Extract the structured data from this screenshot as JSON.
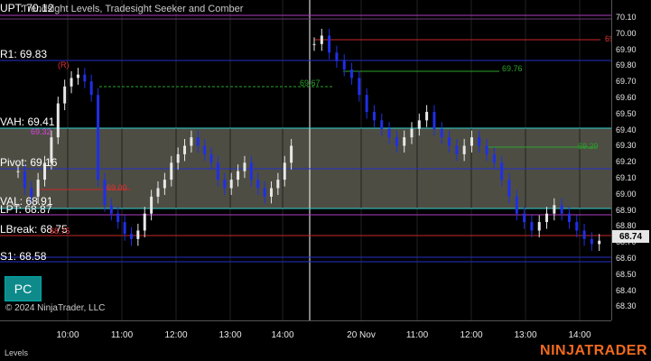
{
  "chart_title": "Trendsight Levels, Tradesight Seeker and Comber",
  "copyright": "© 2024 NinjaTrader, LLC",
  "brand": "NINJATRADER",
  "bottom_tab": "Levels",
  "pc_button": "PC",
  "last_price": "68.74",
  "levels": {
    "upt": "UPT: 70.12",
    "r1": "R1: 69.83",
    "vah": "VAH: 69.41",
    "pivot": "Pivot: 69.16",
    "val": "VAL: 68.91",
    "lpt": "LPT: 68.87",
    "lbreak": "LBreak: 68.75",
    "s1": "S1: 68.58"
  },
  "annotations": {
    "a1": "69.67",
    "a2": "69.76",
    "a3": "69.29",
    "a4": "69.00",
    "a5": "68.75",
    "a6": "69.32",
    "a7": "69",
    "r_mark": "(R)"
  },
  "y_axis": [
    "70.10",
    "70.00",
    "69.90",
    "69.80",
    "69.70",
    "69.60",
    "69.50",
    "69.40",
    "69.30",
    "69.20",
    "69.10",
    "69.00",
    "68.90",
    "68.80",
    "68.70",
    "68.60",
    "68.50",
    "68.40",
    "68.30"
  ],
  "x_axis": [
    "10:00",
    "11:00",
    "12:00",
    "13:00",
    "14:00",
    "20 Nov",
    "11:00",
    "12:00",
    "13:00",
    "14:00"
  ],
  "colors": {
    "background": "#000000",
    "value_area": "#5a5a4f",
    "up_bar": "#e8e8e8",
    "down_bar": "#1f2fe8",
    "r1_line": "#2530c8",
    "va_line": "#31d0d0",
    "upt_line": "#b03cc0",
    "lbreak_line": "#c82828",
    "green_text": "#2aa32a",
    "cyan_text": "#26c6e6",
    "brand": "#f06a1e"
  },
  "chart_data": {
    "type": "candlestick",
    "title": "Trendsight Levels, Tradesight Seeker and Comber",
    "ylim": [
      68.27,
      70.16
    ],
    "x_ticks": [
      "10:00",
      "11:00",
      "12:00",
      "13:00",
      "14:00",
      "20 Nov",
      "11:00",
      "12:00",
      "13:00",
      "14:00"
    ],
    "closes_day1": [
      69.15,
      69.05,
      69.0,
      69.1,
      69.2,
      69.35,
      69.55,
      69.65,
      69.7,
      69.72,
      69.68,
      69.6,
      69.1,
      68.95,
      68.9,
      68.85,
      68.78,
      68.75,
      68.8,
      68.9,
      69.0,
      69.05,
      69.1,
      69.2,
      69.25,
      69.3,
      69.35,
      69.3,
      69.25,
      69.2,
      69.1,
      69.05,
      69.1,
      69.15,
      69.2,
      69.1,
      69.05,
      69.0,
      69.05,
      69.1,
      69.2,
      69.3
    ],
    "closes_day2": [
      69.9,
      69.95,
      69.85,
      69.8,
      69.75,
      69.7,
      69.6,
      69.5,
      69.45,
      69.4,
      69.35,
      69.3,
      69.35,
      69.4,
      69.45,
      69.5,
      69.4,
      69.35,
      69.3,
      69.25,
      69.3,
      69.35,
      69.3,
      69.25,
      69.2,
      69.1,
      69.0,
      68.9,
      68.85,
      68.8,
      68.85,
      68.9,
      68.95,
      68.9,
      68.85,
      68.8,
      68.75,
      68.72,
      68.74
    ]
  }
}
